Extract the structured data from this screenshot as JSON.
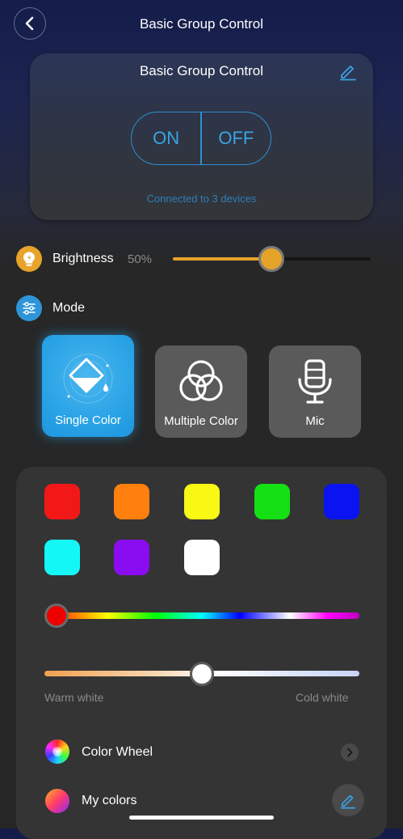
{
  "header": {
    "title": "Basic Group Control",
    "back_icon": "chevron-left-icon"
  },
  "control_card": {
    "title": "Basic Group Control",
    "edit_icon": "pencil-icon",
    "on_label": "ON",
    "off_label": "OFF",
    "connected_text": "Connected to 3 devices"
  },
  "brightness": {
    "label": "Brightness",
    "value_text": "50%",
    "value": 0.5,
    "icon": "bulb-icon",
    "accent": "#E6A32A"
  },
  "mode": {
    "label": "Mode",
    "icon": "sliders-icon",
    "options": [
      {
        "label": "Single Color",
        "icon": "paint-bucket-icon",
        "active": true
      },
      {
        "label": "Multiple Color",
        "icon": "overlapping-circles-icon",
        "active": false
      },
      {
        "label": "Mic",
        "icon": "microphone-icon",
        "active": false
      }
    ]
  },
  "colors": {
    "swatches": [
      "#F21818",
      "#FF7F0F",
      "#F8F814",
      "#14E014",
      "#0A14F0",
      "#14F7F7",
      "#8A0CF0",
      "#FFFFFF"
    ],
    "hue_value": 0.0,
    "temperature_value": 0.5,
    "warm_label": "Warm white",
    "cold_label": "Cold white"
  },
  "list": {
    "color_wheel": {
      "label": "Color Wheel",
      "icon": "color-wheel-icon"
    },
    "my_colors": {
      "label": "My colors",
      "icon": "gradient-circle-icon",
      "edit_icon": "pencil-icon"
    }
  }
}
